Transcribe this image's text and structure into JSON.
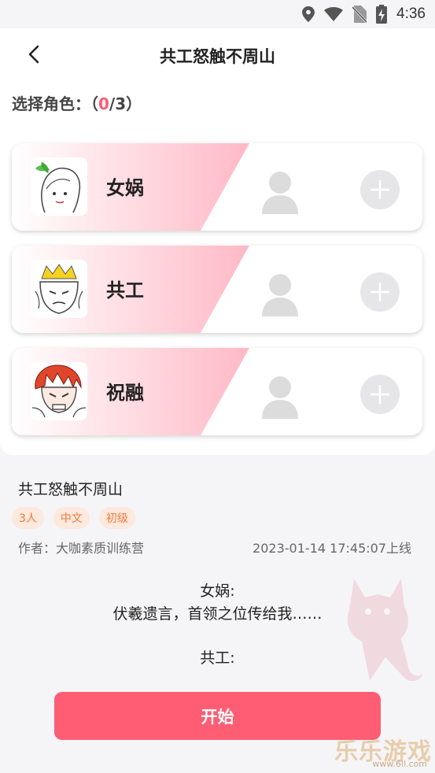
{
  "status_bar": {
    "time": "4:36"
  },
  "header": {
    "title": "共工怒触不周山"
  },
  "role_picker": {
    "label": "选择角色：",
    "open": "（",
    "selected": "0",
    "total": "/3）"
  },
  "roles": [
    {
      "name": "女娲"
    },
    {
      "name": "共工"
    },
    {
      "name": "祝融"
    }
  ],
  "info": {
    "title": "共工怒触不周山",
    "tags": [
      "3人",
      "中文",
      "初级"
    ],
    "author": "作者：大咖素质训练营",
    "published": "2023-01-14 17:45:07上线"
  },
  "dialogue": [
    {
      "speaker": "女娲:",
      "line": "伏羲遗言，首领之位传给我……"
    },
    {
      "speaker": "共工:",
      "line": ""
    }
  ],
  "start_button": "开始",
  "watermark": {
    "text": "乐乐游戏",
    "url": "www.6ll.com"
  },
  "colors": {
    "accent": "#ff5d73",
    "tag_text": "#f07b3a",
    "tag_bg": "#fde9dd"
  }
}
